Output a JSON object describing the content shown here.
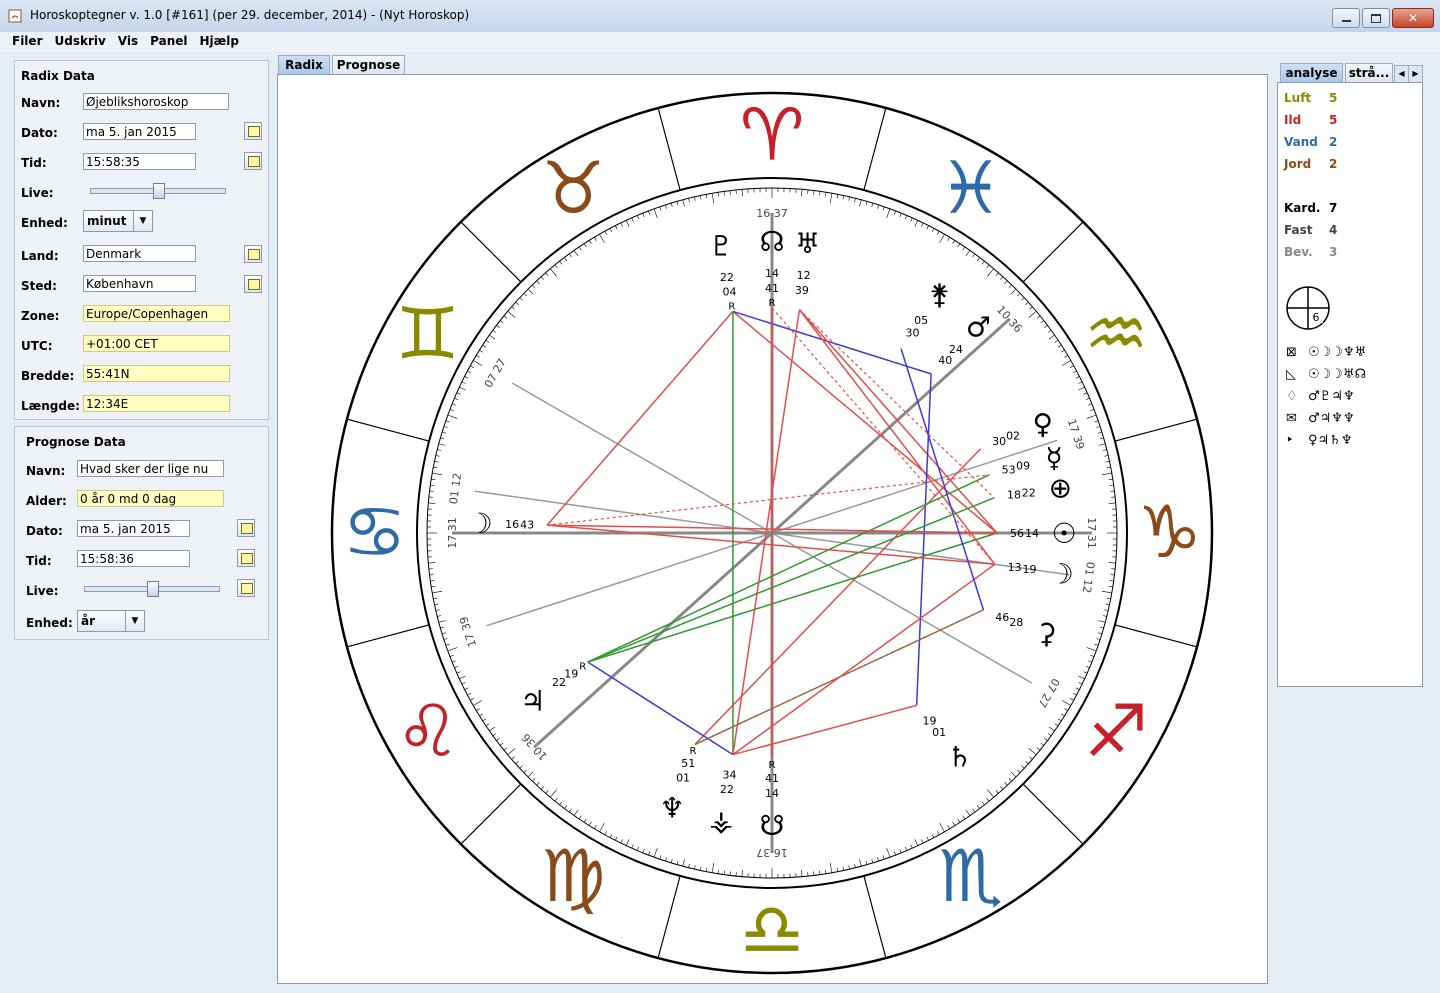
{
  "window": {
    "title": "Horoskoptegner v. 1.0 [#161] (per 29. december, 2014) - (Nyt Horoskop)"
  },
  "menu": {
    "items": [
      "Filer",
      "Udskriv",
      "Vis",
      "Panel",
      "Hjælp"
    ]
  },
  "radix": {
    "title": "Radix Data",
    "name_label": "Navn:",
    "name_value": "Øjeblikshoroskop",
    "date_label": "Dato:",
    "date_value": "ma 5. jan 2015",
    "time_label": "Tid:",
    "time_value": "15:58:35",
    "live_label": "Live:",
    "live_level": 0.5,
    "unit_label": "Enhed:",
    "unit_value": "minut",
    "country_label": "Land:",
    "country_value": "Denmark",
    "place_label": "Sted:",
    "place_value": "København",
    "zone_label": "Zone:",
    "zone_value": "Europe/Copenhagen",
    "utc_label": "UTC:",
    "utc_value": "+01:00 CET",
    "lat_label": "Bredde:",
    "lat_value": "55:41N",
    "lon_label": "Længde:",
    "lon_value": "12:34E"
  },
  "prognose": {
    "title": "Prognose Data",
    "name_label": "Navn:",
    "name_value": "Hvad sker der lige nu",
    "age_label": "Alder:",
    "age_value": "0 år 0 md 0 dag",
    "date_label": "Dato:",
    "date_value": "ma 5. jan 2015",
    "time_label": "Tid:",
    "time_value": "15:58:36",
    "live_label": "Live:",
    "live_level": 0.5,
    "unit_label": "Enhed:",
    "unit_value": "år"
  },
  "tabs": {
    "radix": "Radix",
    "prognose": "Prognose"
  },
  "right_tabs": {
    "analyse": "analyse",
    "straa": "strå..."
  },
  "elements": [
    {
      "label": "Luft",
      "value": "5",
      "color": "#8a8a00"
    },
    {
      "label": "Ild",
      "value": "5",
      "color": "#c8202a"
    },
    {
      "label": "Vand",
      "value": "2",
      "color": "#2f6aa8"
    },
    {
      "label": "Jord",
      "value": "2",
      "color": "#8a4a1a"
    }
  ],
  "modes": [
    {
      "label": "Kard.",
      "value": "7",
      "color": "#000000"
    },
    {
      "label": "Fast",
      "value": "4",
      "color": "#444444"
    },
    {
      "label": "Bev.",
      "value": "3",
      "color": "#888888"
    }
  ],
  "house_symbol_number": "6",
  "aspect_patterns": [
    {
      "icon": "⊠",
      "glyphs": "☉☽☽♆♅"
    },
    {
      "icon": "◺",
      "glyphs": "☉☽☽♅☊"
    },
    {
      "icon": "♢",
      "glyphs": "♂♇♃♆"
    },
    {
      "icon": "✉",
      "glyphs": "♂♃♆♆"
    },
    {
      "icon": "‣",
      "glyphs": "♀♃♄♆"
    }
  ],
  "chart": {
    "signs": [
      {
        "glyph": "♈",
        "color": "#c8202a"
      },
      {
        "glyph": "♉",
        "color": "#8a4a1a"
      },
      {
        "glyph": "♊",
        "color": "#8a8a00"
      },
      {
        "glyph": "♋",
        "color": "#2f6aa8"
      },
      {
        "glyph": "♌",
        "color": "#c8202a"
      },
      {
        "glyph": "♍",
        "color": "#8a4a1a"
      },
      {
        "glyph": "♎",
        "color": "#8a8a00"
      },
      {
        "glyph": "♏",
        "color": "#2f6aa8"
      },
      {
        "glyph": "♐",
        "color": "#c8202a"
      },
      {
        "glyph": "♑",
        "color": "#8a4a1a"
      },
      {
        "glyph": "♒",
        "color": "#8a8a00"
      },
      {
        "glyph": "♓",
        "color": "#2f6aa8"
      }
    ],
    "cusp_labels": [
      "16 37",
      "10 36",
      "17 39",
      "01 12",
      "17 31",
      "07 27",
      "16 37",
      "10 36",
      "17 39",
      "01 12",
      "17 31",
      "07 27"
    ],
    "planets": [
      {
        "glyph": "♇",
        "deg": "22",
        "min": "04",
        "retro": "R"
      },
      {
        "glyph": "☊",
        "deg": "14",
        "min": "41",
        "retro": "R"
      },
      {
        "glyph": "♅",
        "deg": "12",
        "min": "39",
        "retro": ""
      },
      {
        "glyph": "⚵",
        "deg": "05",
        "min": "30",
        "retro": ""
      },
      {
        "glyph": "♂",
        "deg": "24",
        "min": "40",
        "retro": ""
      },
      {
        "glyph": "♀",
        "deg": "02",
        "min": "30",
        "retro": ""
      },
      {
        "glyph": "☿",
        "deg": "09",
        "min": "53",
        "retro": ""
      },
      {
        "glyph": "⊕",
        "deg": "22",
        "min": "18",
        "retro": ""
      },
      {
        "glyph": "☉",
        "deg": "14",
        "min": "56",
        "retro": ""
      },
      {
        "glyph": "☽",
        "deg": "19",
        "min": "13",
        "retro": ""
      },
      {
        "glyph": "⚳",
        "deg": "28",
        "min": "46",
        "retro": ""
      },
      {
        "glyph": "♄",
        "deg": "01",
        "min": "19",
        "retro": ""
      },
      {
        "glyph": "⚶",
        "deg": "22",
        "min": "34",
        "retro": ""
      },
      {
        "glyph": "☋",
        "deg": "14",
        "min": "41",
        "retro": "R"
      },
      {
        "glyph": "♆",
        "deg": "01",
        "min": "51",
        "retro": "R"
      },
      {
        "glyph": "♃",
        "deg": "22",
        "min": "19",
        "retro": "R"
      },
      {
        "glyph": "☽",
        "deg": "16",
        "min": "43",
        "retro": ""
      }
    ]
  }
}
